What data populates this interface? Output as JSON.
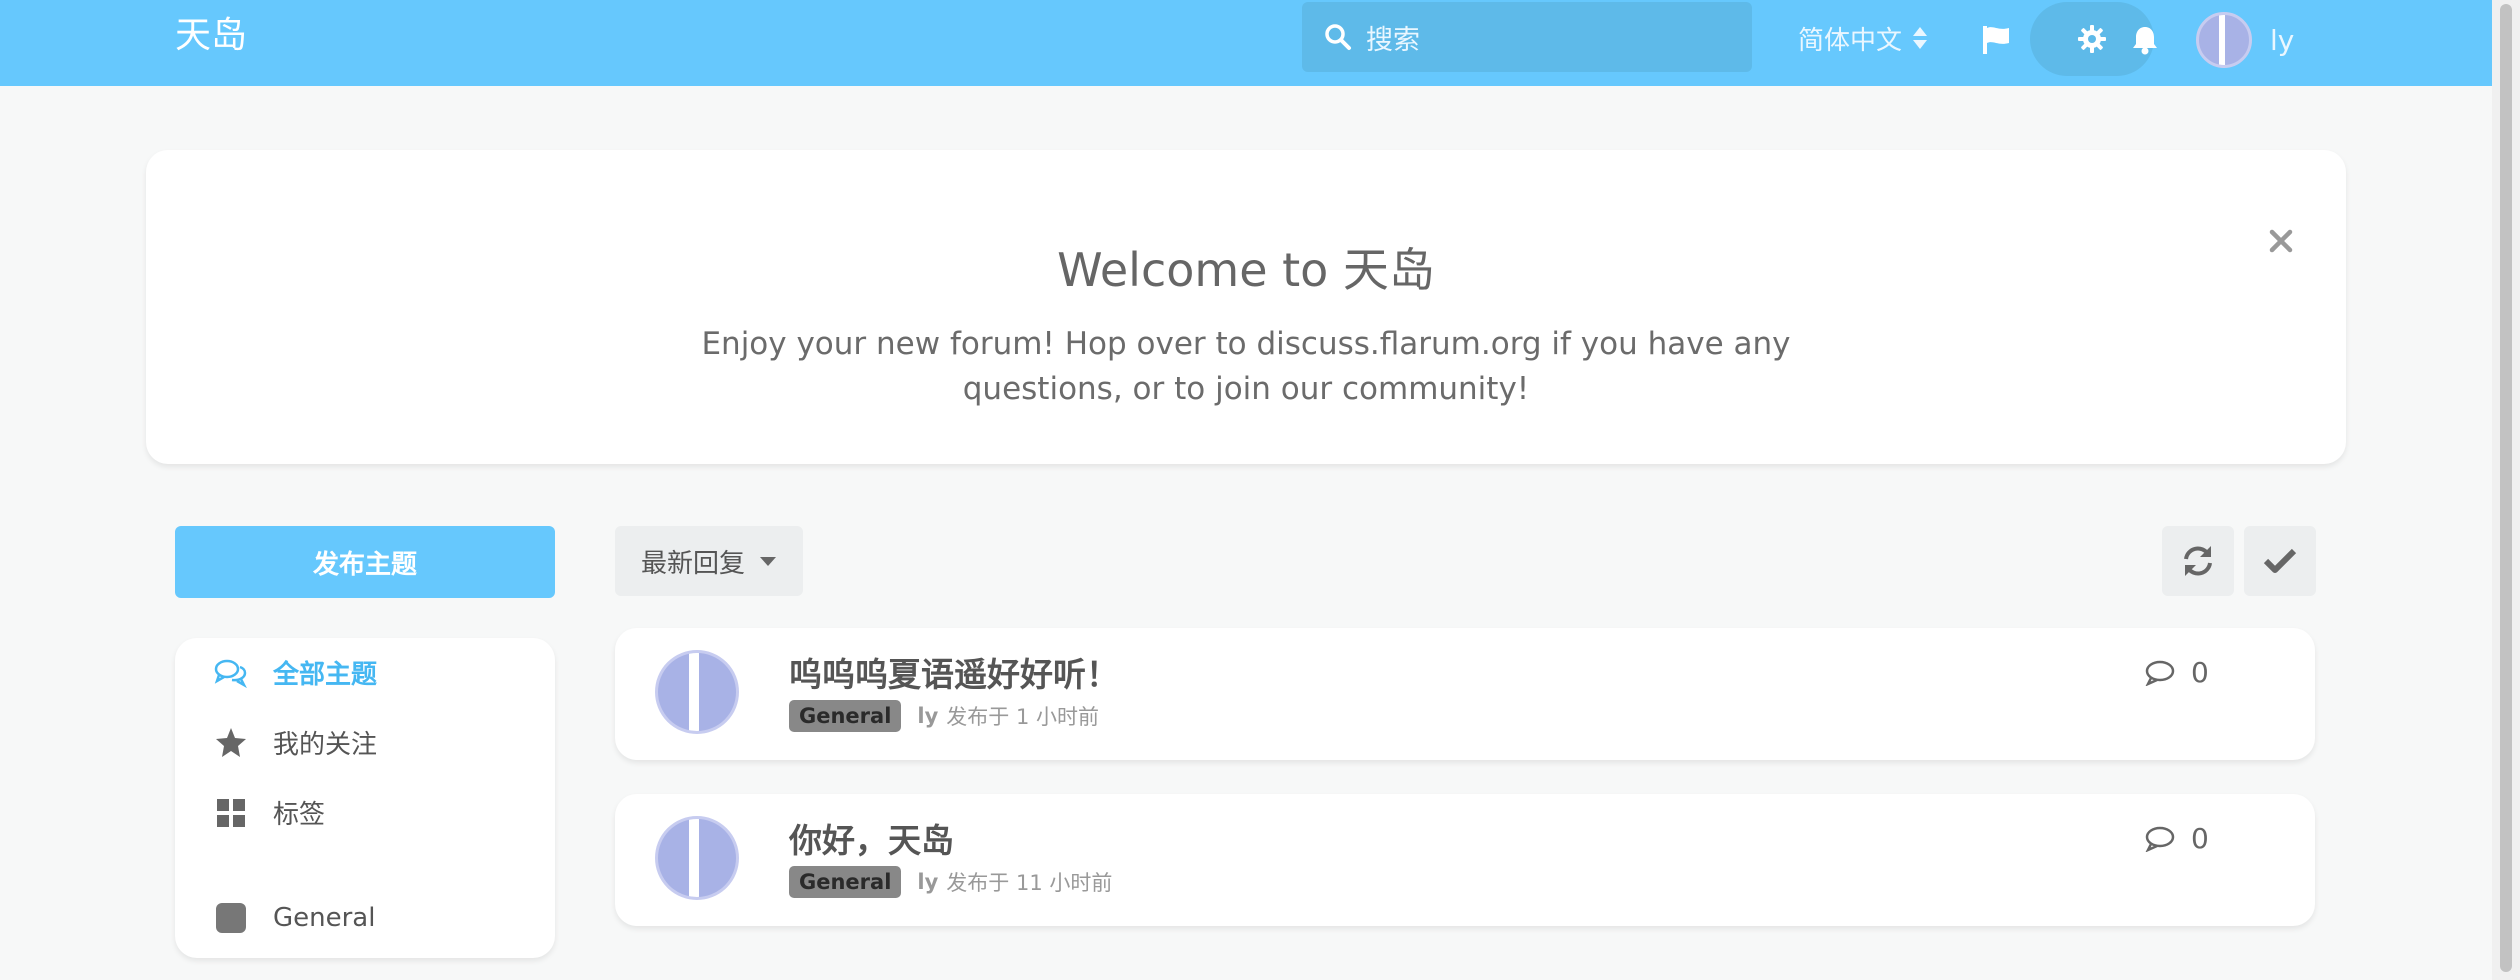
{
  "header": {
    "brand": "天岛",
    "search_placeholder": "搜索",
    "language": "简体中文",
    "username": "ly"
  },
  "hero": {
    "title": "Welcome to 天岛",
    "message": "Enjoy your new forum! Hop over to discuss.flarum.org if you have any questions, or to join our community!"
  },
  "sidebar": {
    "new_topic": "发布主题",
    "items": [
      {
        "label": "全部主题",
        "icon": "comments-icon",
        "active": true
      },
      {
        "label": "我的关注",
        "icon": "star-icon"
      },
      {
        "label": "标签",
        "icon": "tags-grid-icon"
      },
      {
        "label": "General",
        "icon": "tag-square-icon"
      }
    ]
  },
  "toolbar": {
    "sort_label": "最新回复"
  },
  "discussions": [
    {
      "title": "呜呜呜夏语遥好好听！",
      "tag": "General",
      "author": "ly",
      "time": "发布于 1 小时前",
      "replies": "0"
    },
    {
      "title": "你好，天岛",
      "tag": "General",
      "author": "ly",
      "time": "发布于 11 小时前",
      "replies": "0"
    }
  ],
  "colors": {
    "primary": "#66c8fd",
    "active_nav": "#45b7f2",
    "avatar": "#a8b2e6",
    "tag_bg": "#888888"
  }
}
